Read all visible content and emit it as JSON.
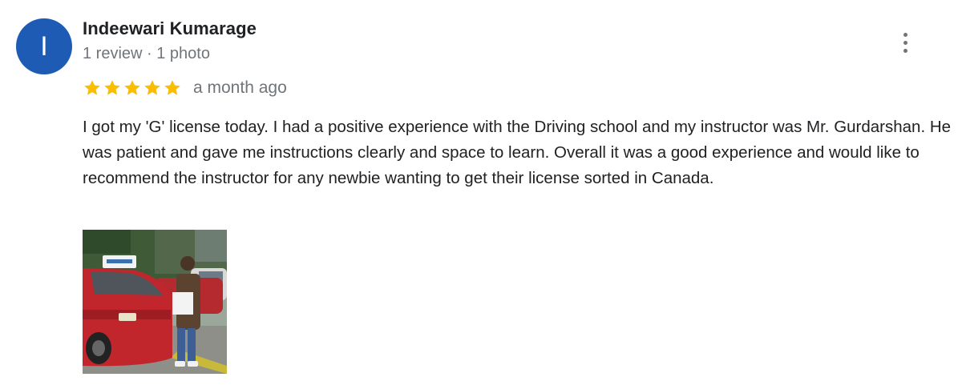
{
  "review": {
    "avatar_initial": "I",
    "avatar_color": "#1e5bb5",
    "reviewer_name": "Indeewari Kumarage",
    "reviewer_meta": "1 review · 1 photo",
    "rating": 5,
    "rating_max": 5,
    "star_color": "#fbbc04",
    "time_ago": "a month ago",
    "text": "I got my 'G' license today. I had a positive experience with the Driving school and my instructor was Mr. Gurdarshan. He was patient and gave me instructions clearly and space to learn. Overall it was a good experience and would like to recommend the instructor for any newbie wanting to get their license sorted in Canada.",
    "more_icon": "more-vert-icon",
    "photo_count": 1
  }
}
